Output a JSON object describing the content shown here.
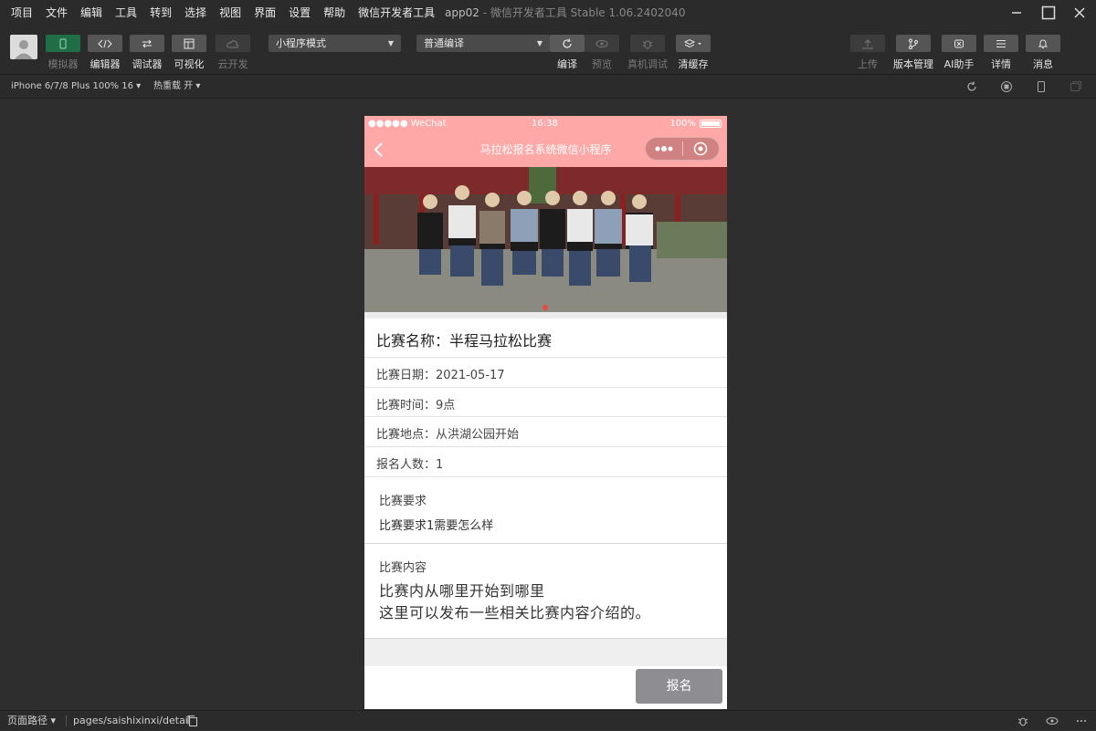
{
  "menubar": {
    "items": [
      "项目",
      "文件",
      "编辑",
      "工具",
      "转到",
      "选择",
      "视图",
      "界面",
      "设置",
      "帮助",
      "微信开发者工具"
    ],
    "app_title": "app02",
    "app_subtitle": "- 微信开发者工具 Stable 1.06.2402040"
  },
  "toolbar": {
    "left_buttons": [
      {
        "label": "模拟器",
        "icon": "phone-icon",
        "active": true,
        "enabled": false
      },
      {
        "label": "编辑器",
        "icon": "code-icon",
        "active": false,
        "enabled": true
      },
      {
        "label": "调试器",
        "icon": "debug-icon",
        "active": false,
        "enabled": true
      },
      {
        "label": "可视化",
        "icon": "layout-icon",
        "active": false,
        "enabled": true
      },
      {
        "label": "云开发",
        "icon": "cloud-icon",
        "active": false,
        "enabled": false
      }
    ],
    "mode_select": "小程序模式",
    "compile_select": "普通编译",
    "mid_buttons": [
      {
        "label": "编译",
        "icon": "refresh-icon",
        "enabled": true
      },
      {
        "label": "预览",
        "icon": "eye-icon",
        "enabled": false
      },
      {
        "label": "真机调试",
        "icon": "bug-icon",
        "enabled": false
      },
      {
        "label": "清缓存",
        "icon": "layers-icon",
        "enabled": true
      }
    ],
    "right_buttons": [
      {
        "label": "上传",
        "icon": "upload-icon",
        "enabled": false
      },
      {
        "label": "版本管理",
        "icon": "branch-icon",
        "enabled": true
      },
      {
        "label": "AI助手",
        "icon": "ai-icon",
        "enabled": true
      },
      {
        "label": "详情",
        "icon": "menu-icon",
        "enabled": true
      },
      {
        "label": "消息",
        "icon": "bell-icon",
        "enabled": true
      }
    ]
  },
  "subbar": {
    "device": "iPhone 6/7/8 Plus 100% 16 ▾",
    "hot_reload": "热重载 开 ▾"
  },
  "phone": {
    "status": {
      "carrier": "●●●●● WeChat",
      "time": "16:38",
      "battery": "100%"
    },
    "nav_title": "马拉松报名系统微信小程序",
    "race_name": "比赛名称：半程马拉松比赛",
    "info_rows": [
      "比赛日期：2021-05-17",
      "比赛时间：9点",
      "比赛地点：从洪湖公园开始",
      "报名人数：1"
    ],
    "requirement": {
      "heading": "比赛要求",
      "body": "比赛要求1需要怎么样"
    },
    "content": {
      "heading": "比赛内容",
      "line1": "比赛内从哪里开始到哪里",
      "line2": "这里可以发布一些相关比赛内容介绍的。"
    },
    "signup_button": "报名"
  },
  "footer": {
    "path_label": "页面路径 ▾",
    "route": "pages/saishixinxi/detail"
  },
  "colors": {
    "nav_bg": "#ffa8a8",
    "ide_bg": "#2b2b2b",
    "signup_bg": "#8d8d92",
    "active_green": "#1f6e45"
  }
}
